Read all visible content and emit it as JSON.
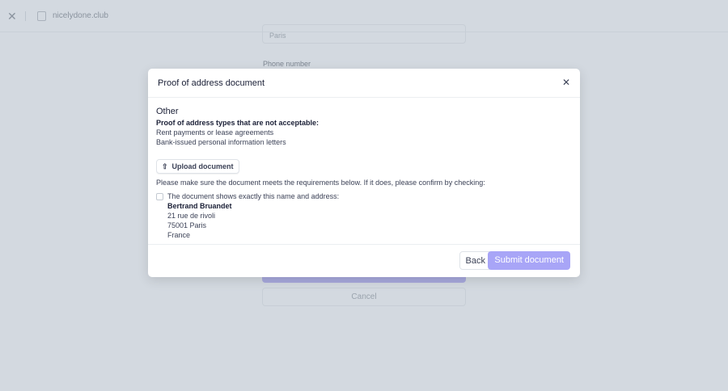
{
  "topbar": {
    "site": "nicelydone.club"
  },
  "background": {
    "city_value": "Paris",
    "phone_label": "Phone number",
    "cancel_label": "Cancel"
  },
  "modal": {
    "title": "Proof of address document",
    "section_title": "Other",
    "not_acceptable_heading": "Proof of address types that are not acceptable:",
    "not_acceptable": [
      "Rent payments or lease agreements",
      "Bank-issued personal information letters"
    ],
    "upload_label": "Upload document",
    "requirements_text": "Please make sure the document meets the requirements below. If it does, please confirm by checking:",
    "checkbox_label": "The document shows exactly this name and address:",
    "checked": false,
    "name": "Bertrand Bruandet",
    "address": [
      "21 rue de rivoli",
      "75001 Paris",
      "France"
    ],
    "back_label": "Back",
    "submit_label": "Submit document"
  }
}
